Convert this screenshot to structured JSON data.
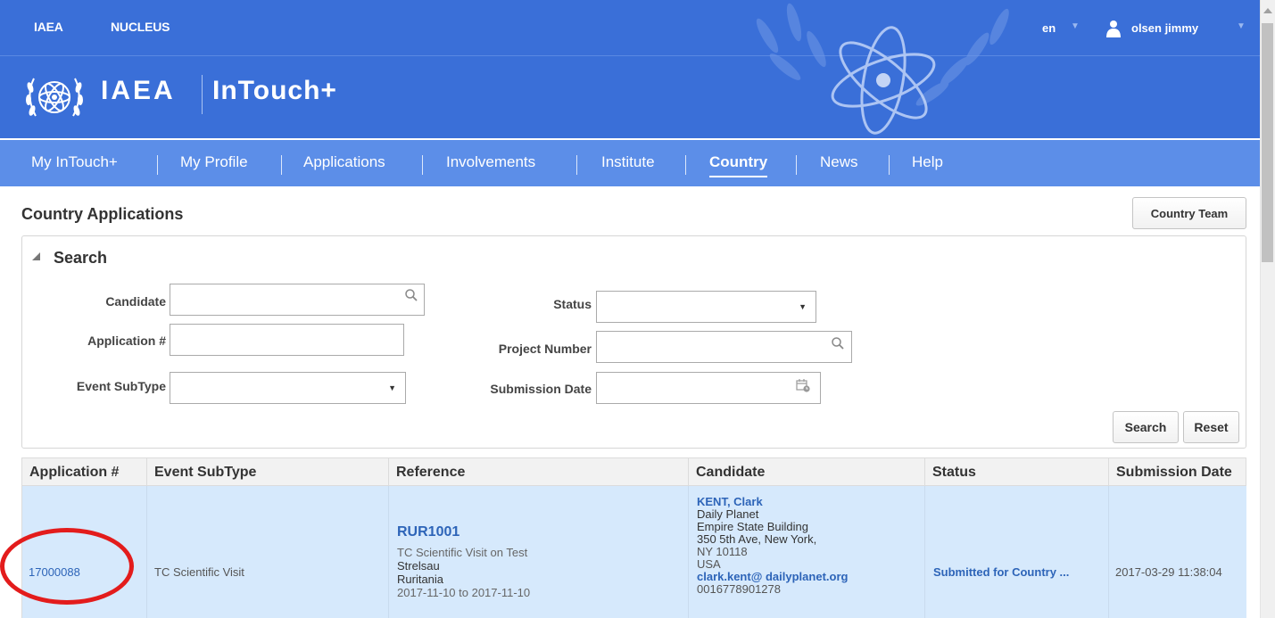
{
  "header": {
    "links": [
      "IAEA",
      "NUCLEUS"
    ],
    "language": "en",
    "user": "olsen jimmy",
    "brand_org": "IAEA",
    "brand_app": "InTouch+"
  },
  "nav": {
    "items": [
      "My InTouch+",
      "My Profile",
      "Applications",
      "Involvements",
      "Institute",
      "Country",
      "News",
      "Help"
    ],
    "active": "Country"
  },
  "page": {
    "title": "Country Applications",
    "country_team_label": "Country Team"
  },
  "search": {
    "title": "Search",
    "candidate_label": "Candidate",
    "candidate_value": "",
    "application_label": "Application #",
    "application_value": "",
    "event_subtype_label": "Event SubType",
    "event_subtype_value": "",
    "status_label": "Status",
    "status_value": "",
    "project_number_label": "Project Number",
    "project_number_value": "",
    "submission_date_label": "Submission Date",
    "submission_date_value": "",
    "search_button": "Search",
    "reset_button": "Reset"
  },
  "table": {
    "columns": [
      "Application #",
      "Event SubType",
      "Reference",
      "Candidate",
      "Status",
      "Submission Date"
    ],
    "rows": [
      {
        "application_no": "17000088",
        "event_subtype": "TC Scientific Visit",
        "reference": {
          "code": "RUR1001",
          "title": "TC Scientific Visit on Test",
          "city": "Strelsau",
          "country": "Ruritania",
          "dates": "2017-11-10 to 2017-11-10"
        },
        "candidate": {
          "name": "KENT, Clark",
          "organization": "Daily Planet",
          "address1": "Empire State Building",
          "address2": "350 5th Ave, New York,",
          "address3": "NY 10118",
          "country": "USA",
          "email": "clark.kent@ dailyplanet.org",
          "phone": "0016778901278"
        },
        "status": "Submitted for Country ...",
        "submission_date": "2017-03-29 11:38:04"
      }
    ]
  },
  "colors": {
    "header_bg": "#3a6fd8",
    "nav_bg": "#5c8ee8",
    "row_highlight": "#d6e9fc",
    "link": "#2d64b8",
    "annotation_circle": "#e31c1c"
  }
}
